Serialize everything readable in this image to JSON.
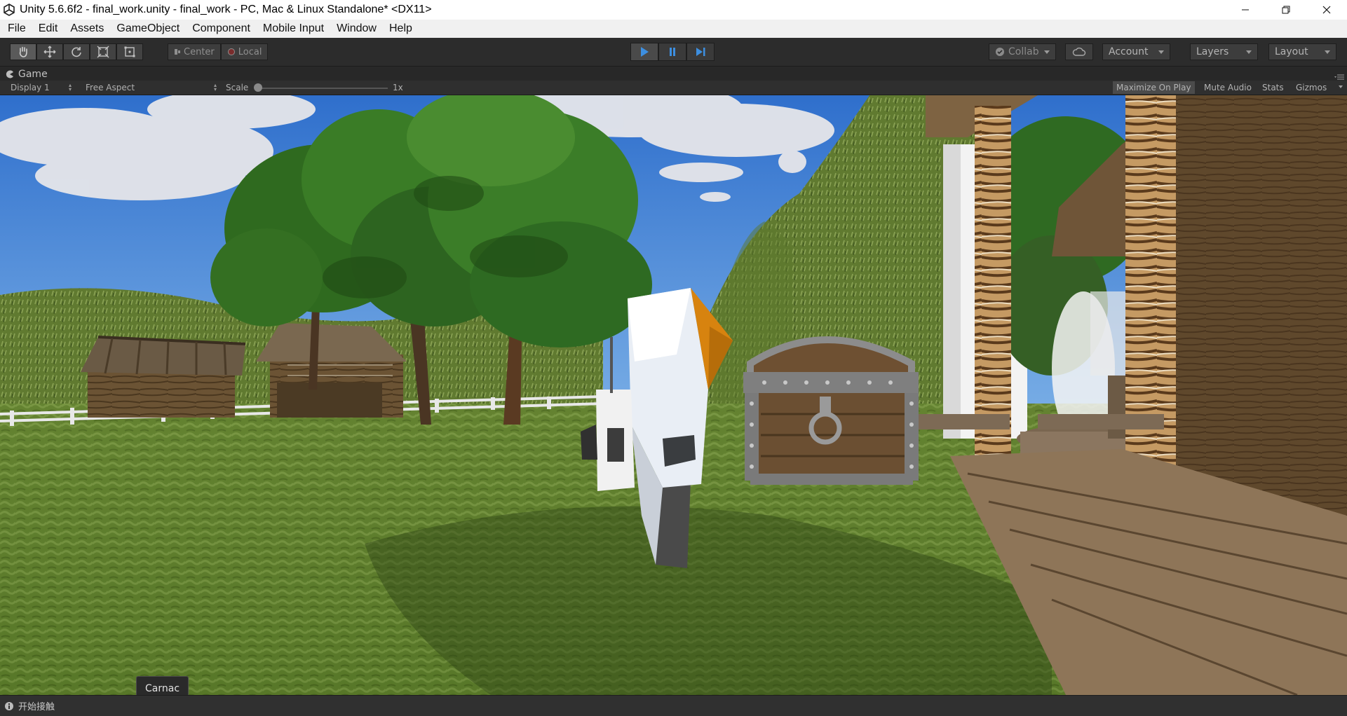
{
  "window": {
    "title": "Unity 5.6.6f2 - final_work.unity - final_work - PC, Mac & Linux Standalone* <DX11>"
  },
  "menu": {
    "items": [
      "File",
      "Edit",
      "Assets",
      "GameObject",
      "Component",
      "Mobile Input",
      "Window",
      "Help"
    ]
  },
  "toolbar": {
    "transform_tools": [
      "hand-icon",
      "move-icon",
      "rotate-icon",
      "scale-icon",
      "rect-icon"
    ],
    "pivot_label": "Center",
    "space_label": "Local",
    "collab_label": "Collab",
    "account_label": "Account",
    "layers_label": "Layers",
    "layout_label": "Layout",
    "play_state": "playing"
  },
  "game_view": {
    "tab_label": "Game",
    "display_label": "Display 1",
    "aspect_label": "Free Aspect",
    "scale_label": "Scale",
    "scale_value": "1x",
    "maximize_label": "Maximize On Play",
    "mute_label": "Mute Audio",
    "stats_label": "Stats",
    "gizmos_label": "Gizmos",
    "maximize_on": true
  },
  "tooltip": {
    "text": "Carnac"
  },
  "status": {
    "message": "开始接触"
  },
  "colors": {
    "toolbar_bg": "#2c2c2c",
    "play_blue": "#3d8fe0",
    "sky_blue": "#3b7fd6",
    "grass": "#5a7a2c"
  }
}
